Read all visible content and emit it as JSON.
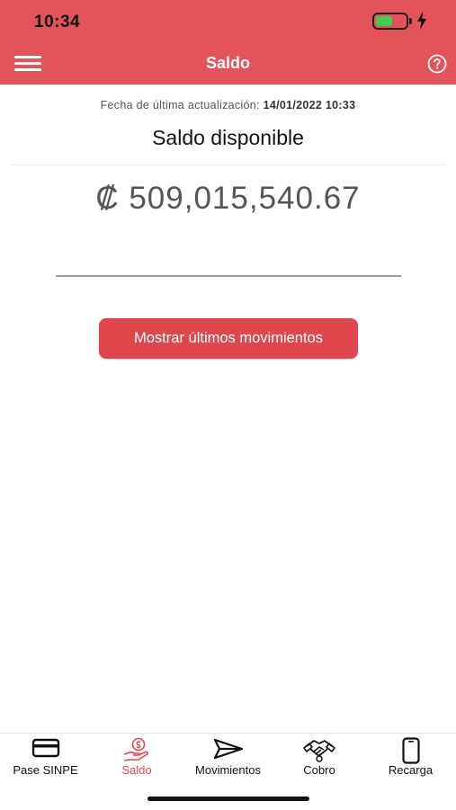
{
  "status_bar": {
    "time": "10:34",
    "battery_level": 0.55
  },
  "header": {
    "title": "Saldo",
    "menu_icon": "hamburger-menu-icon",
    "help_icon": "question-circle-icon"
  },
  "balance": {
    "updated_label": "Fecha de última actualización:",
    "updated_value": "14/01/2022 10:33",
    "title": "Saldo disponible",
    "amount": "₡ 509,015,540.67"
  },
  "actions": {
    "show_movements": "Mostrar últimos movimientos"
  },
  "tabs": [
    {
      "label": "Pase SINPE",
      "icon": "card-icon"
    },
    {
      "label": "Saldo",
      "icon": "hand-coin-icon",
      "active": true
    },
    {
      "label": "Movimientos",
      "icon": "send-icon"
    },
    {
      "label": "Cobro",
      "icon": "handshake-icon"
    },
    {
      "label": "Recarga",
      "icon": "phone-icon"
    }
  ],
  "colors": {
    "brand": "#e2545a",
    "button": "#e0474c",
    "active_tab": "#e0474c"
  }
}
